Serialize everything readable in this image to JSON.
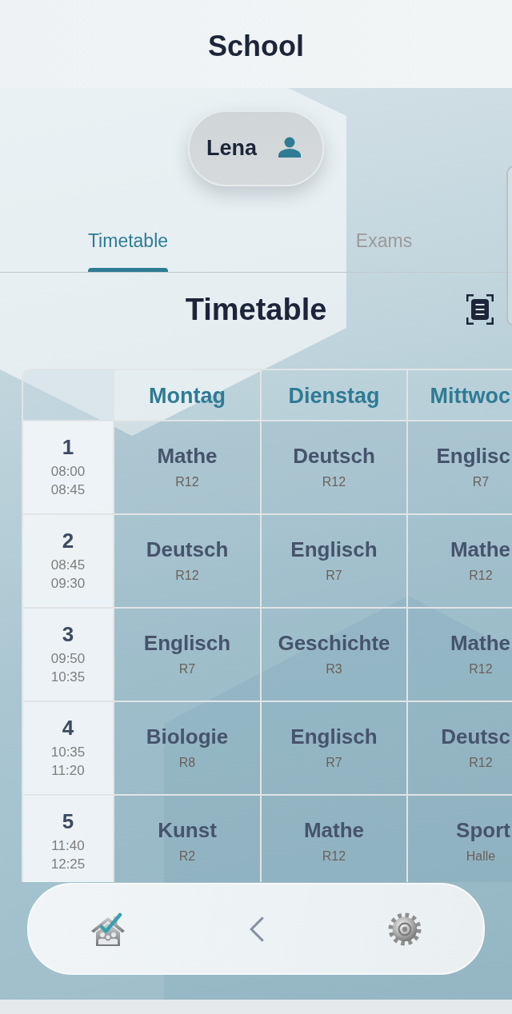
{
  "header": {
    "title": "School"
  },
  "user": {
    "name": "Lena"
  },
  "tabs": [
    {
      "label": "Timetable",
      "selected": true
    },
    {
      "label": "Exams",
      "selected": false
    }
  ],
  "section": {
    "title": "Timetable"
  },
  "timetable": {
    "days": [
      "Montag",
      "Dienstag",
      "Mittwoc"
    ],
    "periods": [
      {
        "number": "1",
        "start": "08:00",
        "end": "08:45",
        "lessons": [
          {
            "subject": "Mathe",
            "room": "R12"
          },
          {
            "subject": "Deutsch",
            "room": "R12"
          },
          {
            "subject": "Englisc",
            "room": "R7"
          }
        ]
      },
      {
        "number": "2",
        "start": "08:45",
        "end": "09:30",
        "lessons": [
          {
            "subject": "Deutsch",
            "room": "R12"
          },
          {
            "subject": "Englisch",
            "room": "R7"
          },
          {
            "subject": "Mathe",
            "room": "R12"
          }
        ]
      },
      {
        "number": "3",
        "start": "09:50",
        "end": "10:35",
        "lessons": [
          {
            "subject": "Englisch",
            "room": "R7"
          },
          {
            "subject": "Geschichte",
            "room": "R3"
          },
          {
            "subject": "Mathe",
            "room": "R12"
          }
        ]
      },
      {
        "number": "4",
        "start": "10:35",
        "end": "11:20",
        "lessons": [
          {
            "subject": "Biologie",
            "room": "R8"
          },
          {
            "subject": "Englisch",
            "room": "R7"
          },
          {
            "subject": "Deutsc",
            "room": "R12"
          }
        ]
      },
      {
        "number": "5",
        "start": "11:40",
        "end": "12:25",
        "lessons": [
          {
            "subject": "Kunst",
            "room": "R2"
          },
          {
            "subject": "Mathe",
            "room": "R12"
          },
          {
            "subject": "Sport",
            "room": "Halle"
          }
        ]
      }
    ]
  }
}
